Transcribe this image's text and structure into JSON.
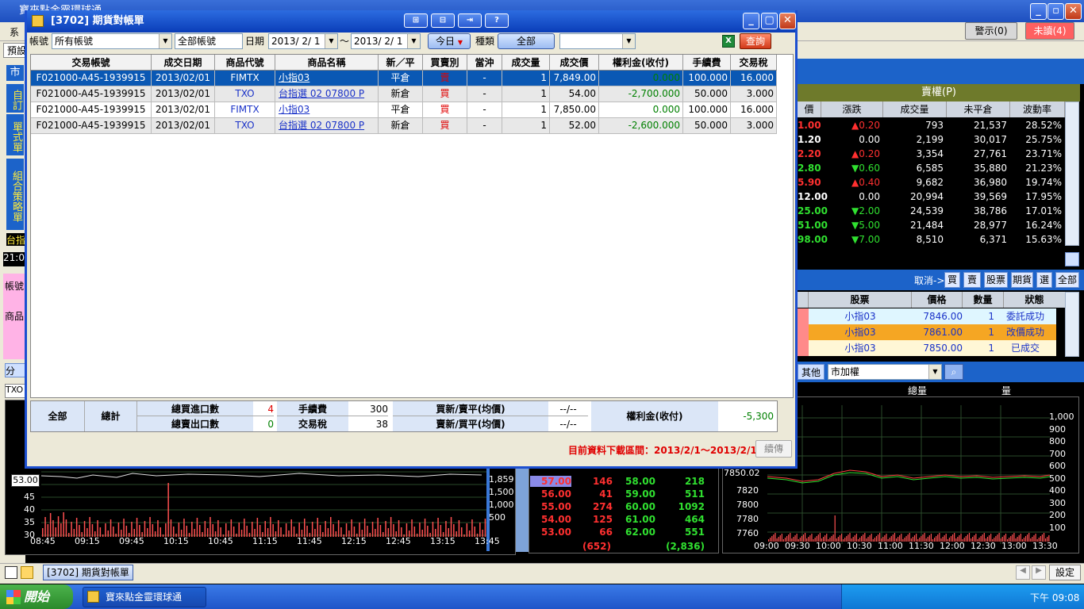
{
  "app": {
    "title": "寶來點金靈環球通",
    "menu_first": "系",
    "tool_first": "預設",
    "nav_market": "市",
    "nav_items": [
      "自訂",
      "單式單",
      "組合策略單"
    ],
    "nav_bottom": "台指",
    "left_time": "21:0",
    "left_account": "帳號",
    "left_product": "商品",
    "left_tab": "分",
    "left_code": "TXO",
    "alert_button": "警示(0)",
    "unread_button": "未讀(4)"
  },
  "dialog": {
    "title": "[3702] 期貨對帳單",
    "account_label": "帳號",
    "account_value": "所有帳號",
    "account_filter": "全部帳號",
    "date_label": "日期",
    "date_from": "2013/ 2/ 1",
    "date_sep": "～",
    "date_to": "2013/ 2/ 1",
    "today_button": "今日",
    "type_label": "種類",
    "type_all_button": "全部",
    "type_select": "",
    "query_button": "查詢",
    "columns": [
      "交易帳號",
      "成交日期",
      "商品代號",
      "商品名稱",
      "新／平",
      "買賣別",
      "當沖",
      "成交量",
      "成交價",
      "權利金(收付)",
      "手續費",
      "交易稅"
    ],
    "rows": [
      {
        "account": "F021000-A45-1939915",
        "date": "2013/02/01",
        "code": "FIMTX",
        "name": "小指03",
        "open_close": "平倉",
        "side": "賣",
        "daytrade": "-",
        "qty": "1",
        "price": "7,849.00",
        "premium": "0.000",
        "fee": "100.000",
        "tax": "16.000"
      },
      {
        "account": "F021000-A45-1939915",
        "date": "2013/02/01",
        "code": "TXO",
        "name": "台指選 02 07800 P",
        "open_close": "新倉",
        "side": "買",
        "daytrade": "-",
        "qty": "1",
        "price": "54.00",
        "premium": "-2,700.000",
        "fee": "50.000",
        "tax": "3.000"
      },
      {
        "account": "F021000-A45-1939915",
        "date": "2013/02/01",
        "code": "FIMTX",
        "name": "小指03",
        "open_close": "平倉",
        "side": "買",
        "daytrade": "-",
        "qty": "1",
        "price": "7,850.00",
        "premium": "0.000",
        "fee": "100.000",
        "tax": "16.000"
      },
      {
        "account": "F021000-A45-1939915",
        "date": "2013/02/01",
        "code": "TXO",
        "name": "台指選 02 07800 P",
        "open_close": "新倉",
        "side": "買",
        "daytrade": "-",
        "qty": "1",
        "price": "52.00",
        "premium": "-2,600.000",
        "fee": "50.000",
        "tax": "3.000"
      }
    ],
    "summary": {
      "all": "全部",
      "total": "總計",
      "buy_in_label": "總買進口數",
      "buy_in": "4",
      "sell_out_label": "總賣出口數",
      "sell_out": "0",
      "fee_label": "手續費",
      "fee": "300",
      "tax_label": "交易稅",
      "tax": "38",
      "buynew_label": "買新/賣平(均價)",
      "buynew": "--/--",
      "sellnew_label": "賣新/買平(均價)",
      "sellnew": "--/--",
      "premium_label": "權利金(收付)",
      "premium": "-5,300"
    },
    "range_text": "目前資料下載區間：2013/2/1～2013/2/1",
    "continue_button": "續傳"
  },
  "right": {
    "header": "賣權(P)",
    "columns": [
      "價",
      "漲跌",
      "成交量",
      "未平倉",
      "波動率"
    ],
    "rows": [
      {
        "price": "1.00",
        "chg": "▲0.20",
        "vol": "793",
        "oi": "21,537",
        "iv": "28.52%",
        "pc": "#ff3030",
        "cc": "#ff3030"
      },
      {
        "price": "1.20",
        "chg": "0.00",
        "vol": "2,199",
        "oi": "30,017",
        "iv": "25.75%",
        "pc": "#ffffff",
        "cc": "#ffffff"
      },
      {
        "price": "2.20",
        "chg": "▲0.20",
        "vol": "3,354",
        "oi": "27,761",
        "iv": "23.71%",
        "pc": "#ff3030",
        "cc": "#ff3030"
      },
      {
        "price": "2.80",
        "chg": "▼0.60",
        "vol": "6,585",
        "oi": "35,880",
        "iv": "21.23%",
        "pc": "#30e030",
        "cc": "#30e030"
      },
      {
        "price": "5.90",
        "chg": "▲0.40",
        "vol": "9,682",
        "oi": "36,980",
        "iv": "19.74%",
        "pc": "#ff3030",
        "cc": "#ff3030"
      },
      {
        "price": "12.00",
        "chg": "0.00",
        "vol": "20,994",
        "oi": "39,569",
        "iv": "17.95%",
        "pc": "#ffffff",
        "cc": "#ffffff"
      },
      {
        "price": "25.00",
        "chg": "▼2.00",
        "vol": "24,539",
        "oi": "38,786",
        "iv": "17.01%",
        "pc": "#30e030",
        "cc": "#30e030"
      },
      {
        "price": "51.00",
        "chg": "▼5.00",
        "vol": "21,484",
        "oi": "28,977",
        "iv": "16.24%",
        "pc": "#30e030",
        "cc": "#30e030"
      },
      {
        "price": "98.00",
        "chg": "▼7.00",
        "vol": "8,510",
        "oi": "6,371",
        "iv": "15.63%",
        "pc": "#30e030",
        "cc": "#30e030"
      }
    ],
    "cancel_label": "取消->",
    "cancel_buttons": [
      "買",
      "賣",
      "股票",
      "期貨",
      "選",
      "全部"
    ],
    "order_columns": [
      "股票",
      "價格",
      "數量",
      "狀態"
    ],
    "orders": [
      {
        "stock": "小指03",
        "price": "7846.00",
        "qty": "1",
        "status": "委託成功",
        "bg": "#dff6ff"
      },
      {
        "stock": "小指03",
        "price": "7861.00",
        "qty": "1",
        "status": "改價成功",
        "bg": "#f5a623"
      },
      {
        "stock": "小指03",
        "price": "7850.00",
        "qty": "1",
        "status": "已成交",
        "bg": "#fff7d6"
      }
    ],
    "other_button": "其他",
    "market_select": "市加權",
    "total_label": "總量",
    "volume_label": "量"
  },
  "chart_left": {
    "current": "53.00",
    "yticks": [
      "45",
      "40",
      "35",
      "30"
    ],
    "y2ticks": [
      "1,859",
      "1,500",
      "1,000",
      "500"
    ],
    "xticks": [
      "08:45",
      "09:15",
      "09:45",
      "10:15",
      "10:45",
      "11:15",
      "11:45",
      "12:15",
      "12:45",
      "13:15",
      "13:45"
    ]
  },
  "orderbook": {
    "rows": [
      {
        "bidp": "57.00",
        "bidq": "146",
        "askp": "58.00",
        "askq": "218"
      },
      {
        "bidp": "56.00",
        "bidq": "41",
        "askp": "59.00",
        "askq": "511"
      },
      {
        "bidp": "55.00",
        "bidq": "274",
        "askp": "60.00",
        "askq": "1092"
      },
      {
        "bidp": "54.00",
        "bidq": "125",
        "askp": "61.00",
        "askq": "464"
      },
      {
        "bidp": "53.00",
        "bidq": "66",
        "askp": "62.00",
        "askq": "551"
      }
    ],
    "bid_total": "(652)",
    "ask_total": "(2,836)"
  },
  "chart_right": {
    "current": "7850.02",
    "yticks": [
      "7820",
      "7800",
      "7780",
      "7760"
    ],
    "y2ticks": [
      "1,000",
      "900",
      "800",
      "700",
      "600",
      "500",
      "400",
      "300",
      "200",
      "100"
    ],
    "xticks": [
      "09:00",
      "09:30",
      "10:00",
      "10:30",
      "11:00",
      "11:30",
      "12:00",
      "12:30",
      "13:00",
      "13:30"
    ]
  },
  "statusbar": {
    "task": "[3702] 期貨對帳單",
    "settings": "設定"
  },
  "taskbar": {
    "start": "開始",
    "window": "寶來點金靈環球通",
    "clock": "下午 09:08"
  }
}
